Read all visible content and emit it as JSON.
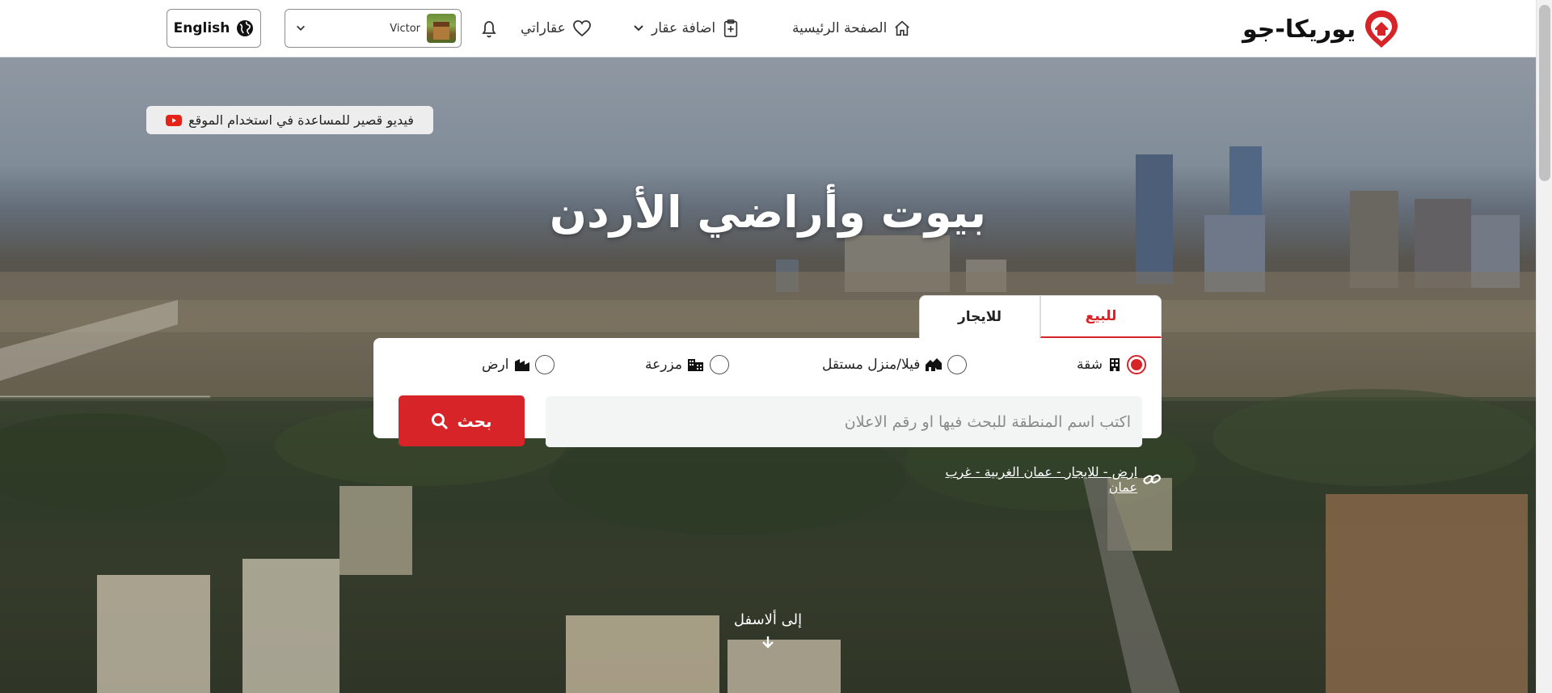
{
  "navbar": {
    "logo_text": "يوريكا-جو",
    "home_label": "الصفحة الرئيسية",
    "add_property_label": "اضافة عقار",
    "favorites_label": "عقاراتي",
    "user_name": "Victor",
    "language_label": "English"
  },
  "hero": {
    "help_video_label": "فيديو قصير للمساعدة في استخدام الموقع",
    "title": "بيوت وأراضي الأردن",
    "scroll_down_label": "إلى ألاسفل"
  },
  "search": {
    "tabs": [
      {
        "label": "للبيع",
        "active": true
      },
      {
        "label": "للايجار",
        "active": false
      }
    ],
    "property_types": [
      {
        "label": "شقة",
        "icon": "building-icon",
        "checked": true
      },
      {
        "label": "فيلا/منزل مستقل",
        "icon": "houses-icon",
        "checked": false
      },
      {
        "label": "مزرعة",
        "icon": "farm-building-icon",
        "checked": false
      },
      {
        "label": "ارض",
        "icon": "land-icon",
        "checked": false
      }
    ],
    "input_placeholder": "اكتب اسم المنطقة للبحث فيها او رقم الاعلان",
    "input_value": "",
    "button_label": "بحث",
    "quick_link": "ارض - للايجار - عمان الغربية - غرب عمان"
  },
  "colors": {
    "brand_red": "#d62429",
    "input_bg": "#f3f5f4"
  }
}
